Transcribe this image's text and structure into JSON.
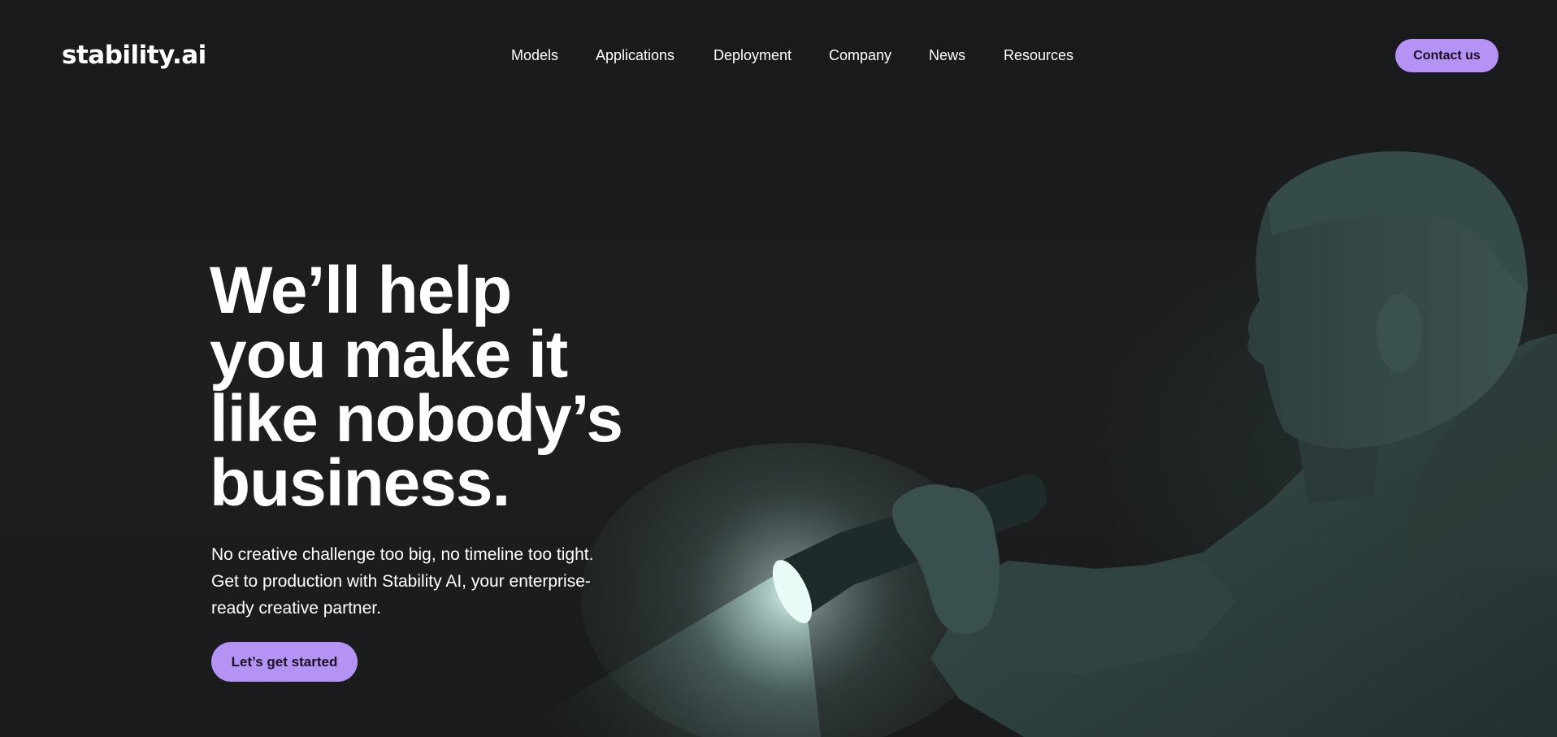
{
  "header": {
    "logo_text": "stability.ai",
    "nav_items": [
      {
        "label": "Models"
      },
      {
        "label": "Applications"
      },
      {
        "label": "Deployment"
      },
      {
        "label": "Company"
      },
      {
        "label": "News"
      },
      {
        "label": "Resources"
      }
    ],
    "contact_label": "Contact us"
  },
  "hero": {
    "headline_lines": [
      "We’ll help",
      "you make it",
      "like nobody’s",
      "business."
    ],
    "subtext_lines": [
      "No creative challenge too big, no timeline too tight.",
      "Get to production with Stability AI, your enterprise-",
      "ready creative partner."
    ],
    "cta_label": "Let’s get started",
    "image_subject": "person-with-flashlight"
  },
  "colors": {
    "background": "#1b1c1d",
    "accent": "#b493f5",
    "text": "#ffffff",
    "button_text": "#1a1220",
    "figure_tint": "#2e4341"
  }
}
